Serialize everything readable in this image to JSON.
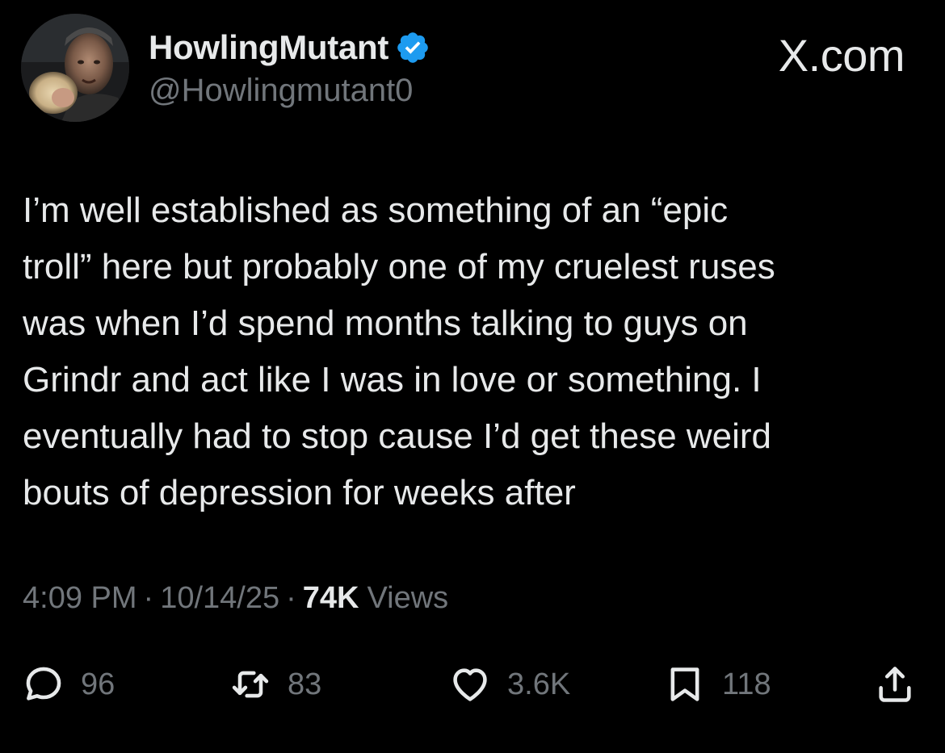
{
  "author": {
    "display_name": "HowlingMutant",
    "handle": "@Howlingmutant0",
    "verified": true,
    "verified_color": "#1d9bf0",
    "avatar_icon": "avatar-photo"
  },
  "site_label": "X.com",
  "tweet": {
    "text": "I’m well established as something of an “epic\ntroll” here but probably one of my cruelest ruses\nwas when I’d spend months talking to guys on\nGrindr and act like I was in love or something.  I\neventually had to stop cause I’d get these weird\nbouts of depression for weeks after"
  },
  "meta": {
    "time": "4:09 PM",
    "separator": "·",
    "date": "10/14/25",
    "views_count": "74K",
    "views_label": "Views"
  },
  "actions": {
    "reply": {
      "icon": "reply-icon",
      "count": "96"
    },
    "retweet": {
      "icon": "retweet-icon",
      "count": "83"
    },
    "like": {
      "icon": "heart-icon",
      "count": "3.6K"
    },
    "bookmark": {
      "icon": "bookmark-icon",
      "count": "118"
    },
    "share": {
      "icon": "share-icon"
    }
  },
  "colors": {
    "background": "#000000",
    "primary_text": "#e7e9ea",
    "secondary_text": "#71767b"
  }
}
